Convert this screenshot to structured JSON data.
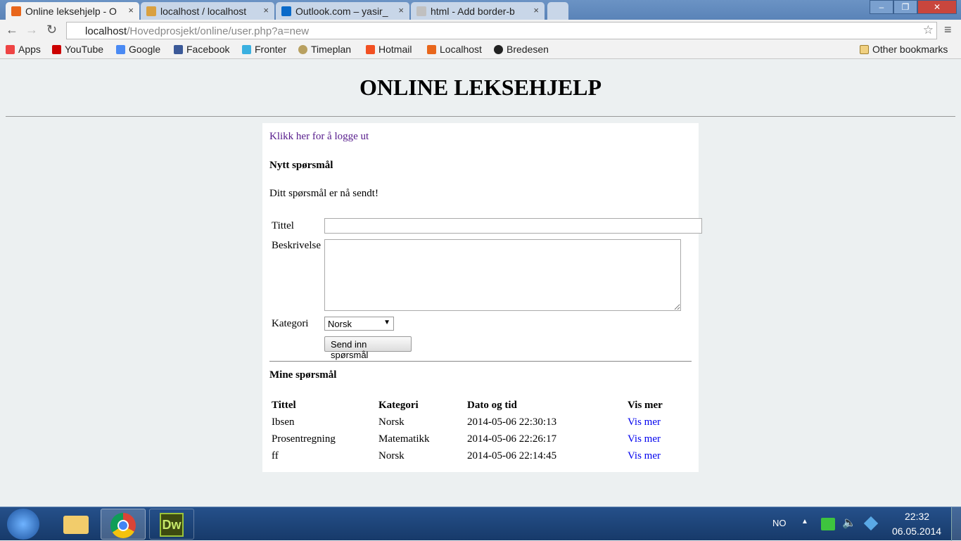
{
  "browser": {
    "tabs": [
      {
        "label": "Online leksehjelp - O",
        "active": true,
        "color": "#e8661b"
      },
      {
        "label": "localhost / localhost",
        "color": "#d9a040"
      },
      {
        "label": "Outlook.com – yasir_",
        "color": "#0a6ac9"
      },
      {
        "label": "html - Add border-b",
        "color": "#c0c0c0"
      }
    ],
    "url_host": "localhost",
    "url_path": "/Hovedprosjekt/online/user.php?a=new",
    "bookmarks": [
      {
        "label": "Apps",
        "color": "#e44"
      },
      {
        "label": "YouTube",
        "color": "#c00"
      },
      {
        "label": "Google",
        "color": "#4a8af4"
      },
      {
        "label": "Facebook",
        "color": "#3b5998"
      },
      {
        "label": "Fronter",
        "color": "#3ab0e0"
      },
      {
        "label": "Timeplan",
        "color": "#b8a060"
      },
      {
        "label": "Hotmail",
        "color": "#f25022"
      },
      {
        "label": "Localhost",
        "color": "#e8661b"
      },
      {
        "label": "Bredesen",
        "color": "#222"
      }
    ],
    "other_bookmarks": "Other bookmarks"
  },
  "page": {
    "title": "ONLINE LEKSEHJELP",
    "logout": "Klikk her for å logge ut",
    "new_heading": "Nytt spørsmål",
    "sent_msg": "Ditt spørsmål er nå sendt!",
    "form": {
      "title_label": "Tittel",
      "title_value": "",
      "desc_label": "Beskrivelse",
      "desc_value": "",
      "cat_label": "Kategori",
      "cat_value": "Norsk",
      "submit": "Send inn spørsmål"
    },
    "mine_heading": "Mine spørsmål",
    "table": {
      "headers": [
        "Tittel",
        "Kategori",
        "Dato og tid",
        "Vis mer"
      ],
      "rows": [
        [
          "Ibsen",
          "Norsk",
          "2014-05-06 22:30:13",
          "Vis mer"
        ],
        [
          "Prosentregning",
          "Matematikk",
          "2014-05-06 22:26:17",
          "Vis mer"
        ],
        [
          "ff",
          "Norsk",
          "2014-05-06 22:14:45",
          "Vis mer"
        ]
      ]
    }
  },
  "taskbar": {
    "lang": "NO",
    "time": "22:32",
    "date": "06.05.2014",
    "dw": "Dw"
  }
}
